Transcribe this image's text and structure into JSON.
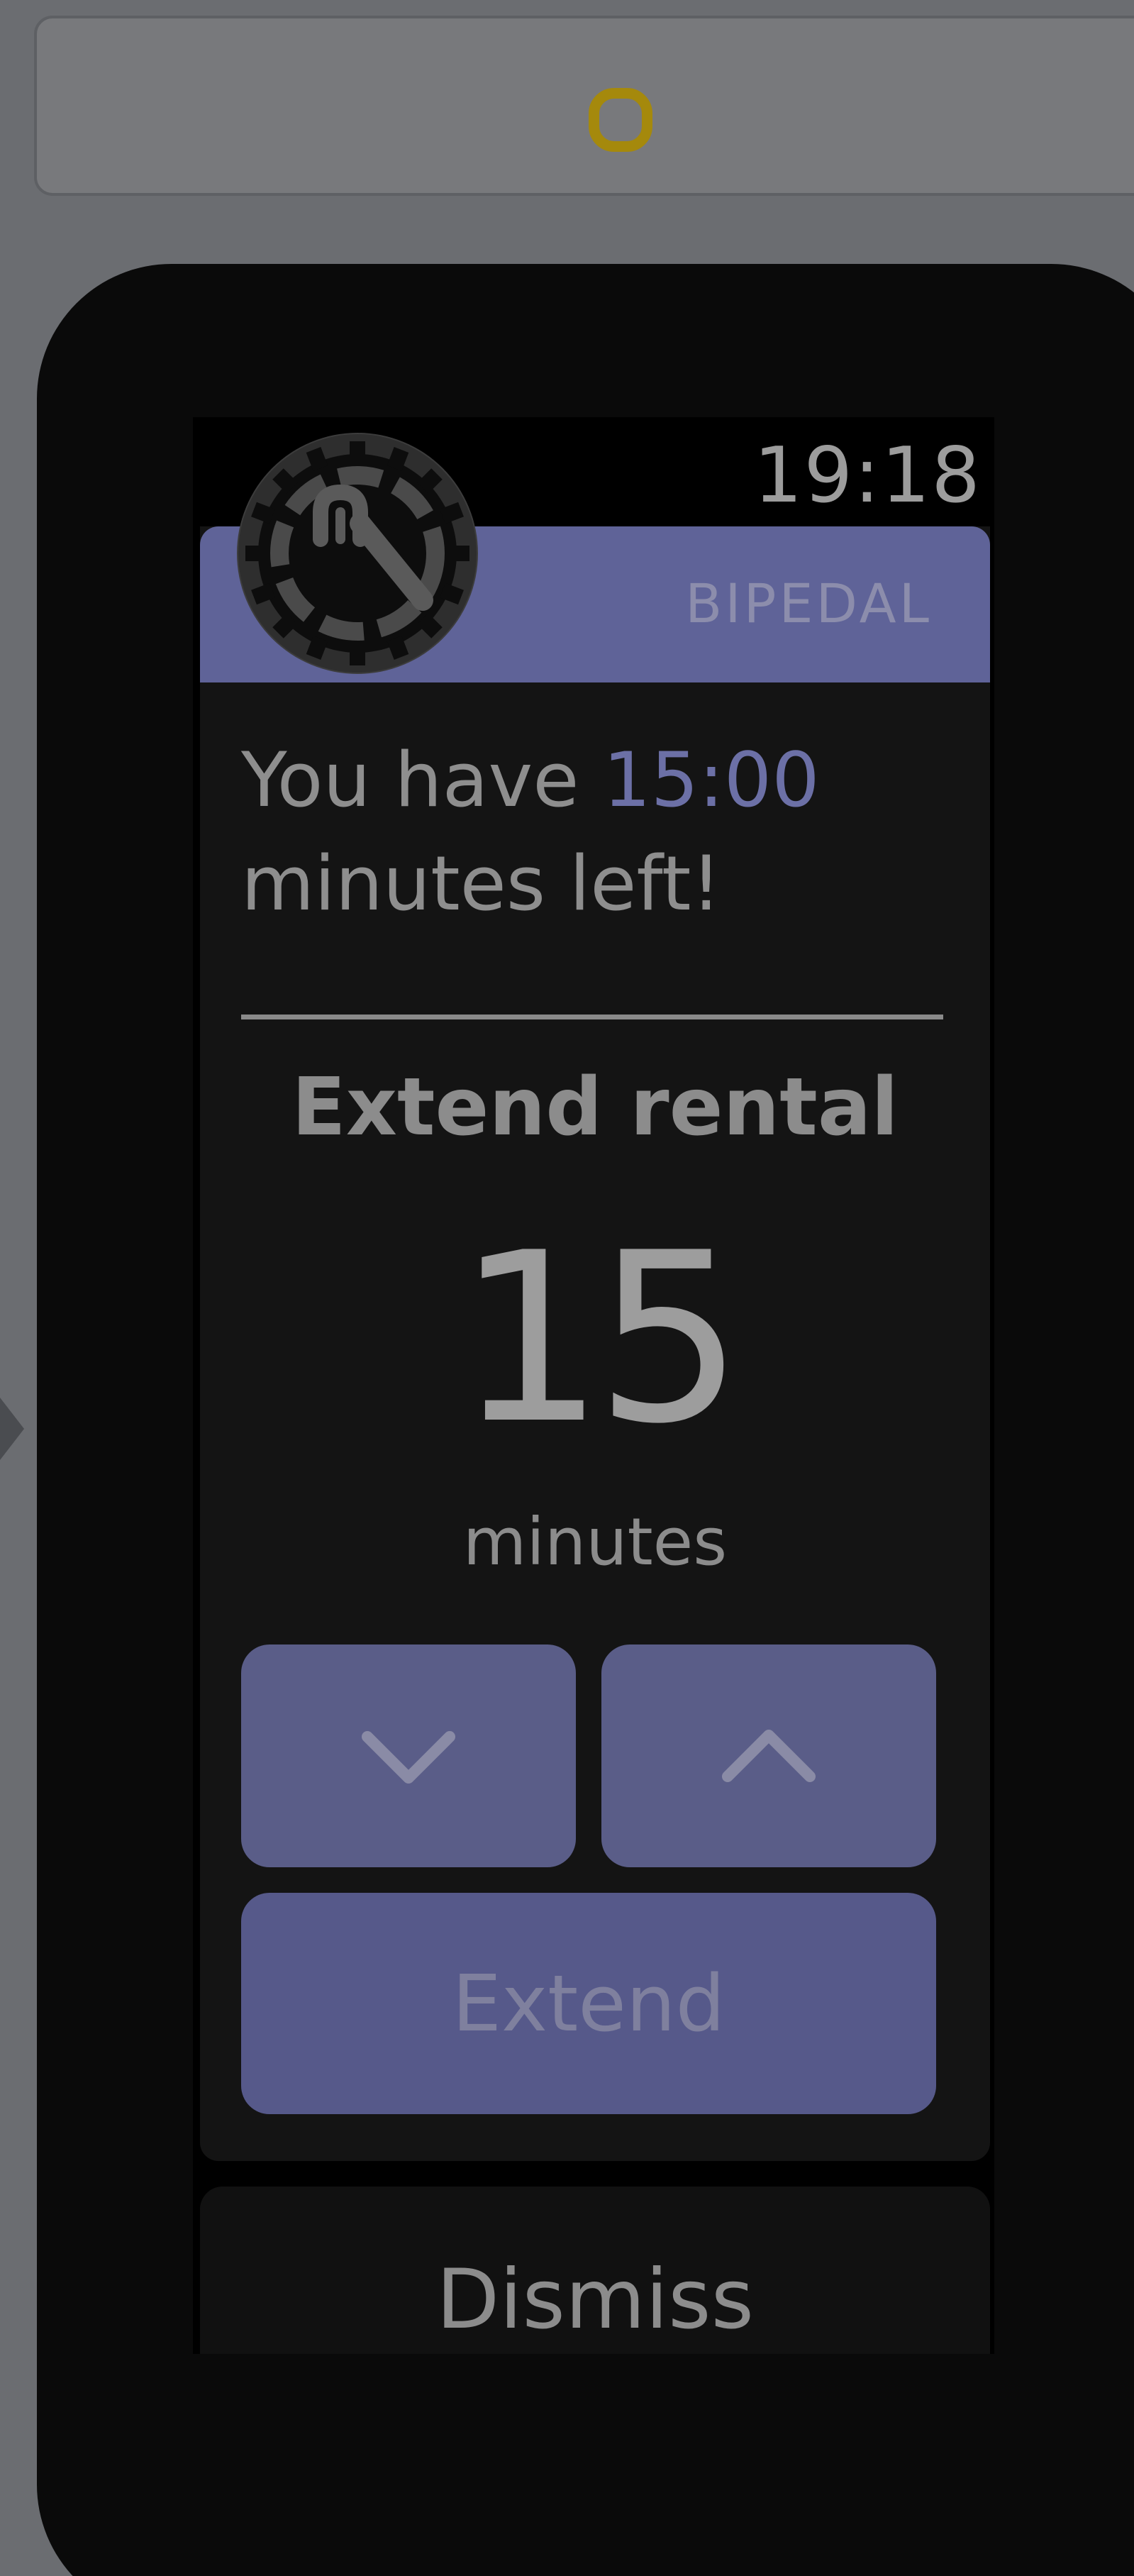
{
  "toolbar": {
    "stop_icon": "stop-icon",
    "accent_color": "#a5890c"
  },
  "watch": {
    "time": "19:18",
    "app_name": "BIPEDAL",
    "app_icon": "gear-bike-logo-icon",
    "message": {
      "prefix": "You have ",
      "time_left": "15:00",
      "suffix": " minutes left!"
    },
    "extend_section": {
      "title": "Extend rental",
      "minutes_value": "15",
      "minutes_label": "minutes",
      "decrease_icon": "chevron-down-icon",
      "increase_icon": "chevron-up-icon",
      "extend_label": "Extend"
    },
    "dismiss_label": "Dismiss",
    "colors": {
      "header": "#5f6398",
      "button": "#5a5d88",
      "highlight": "#6c70a6"
    }
  }
}
